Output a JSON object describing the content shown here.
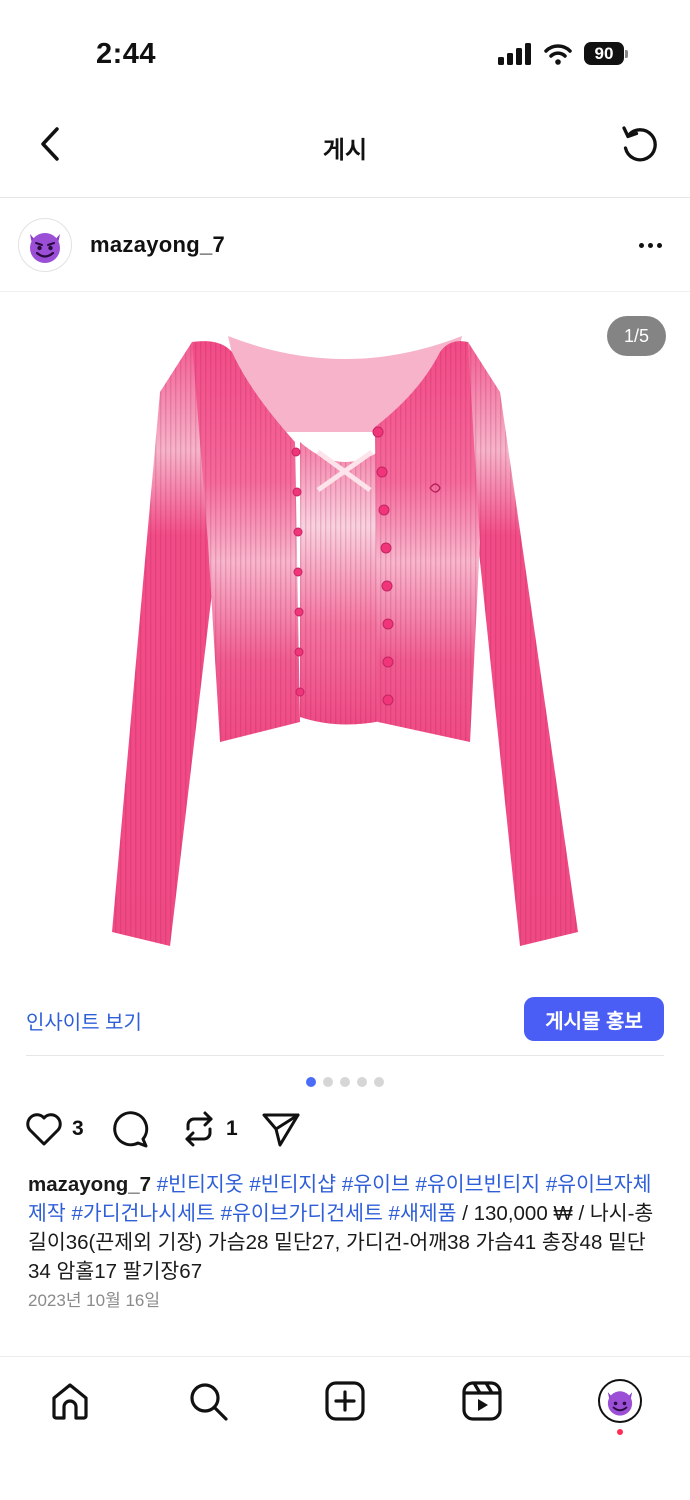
{
  "status_bar": {
    "time": "2:44",
    "battery": "90"
  },
  "header": {
    "title": "게시"
  },
  "post": {
    "username": "mazayong_7",
    "avatar_icon": "smiling-devil-emoji",
    "image_counter": "1/5",
    "insight_link": "인사이트 보기",
    "promote_button": "게시물 홍보",
    "carousel": {
      "total": 5,
      "active_index": 0
    },
    "likes": "3",
    "reposts": "1",
    "caption": {
      "username": "mazayong_7",
      "hashtags": [
        "#빈티지옷",
        "#빈티지샵",
        "#유이브",
        "#유이브빈티지",
        "#유이브자체제작",
        "#가디건나시세트",
        "#유이브가디건세트",
        "#새제품"
      ],
      "body": " / 130,000 ₩ / 나시-총길이36(끈제외 기장) 가슴28 밑단27, 가디건-어깨38 가슴41 총장48 밑단34 암홀17 팔기장67"
    },
    "date": "2023년 10월 16일"
  },
  "colors": {
    "accent": "#4a5ef5",
    "link": "#2f5fd8",
    "garment_pink": "#f24a86",
    "notification": "#ff2d55"
  },
  "bottom_nav": {
    "items": [
      "home-icon",
      "search-icon",
      "create-icon",
      "reels-icon",
      "profile-avatar"
    ]
  }
}
